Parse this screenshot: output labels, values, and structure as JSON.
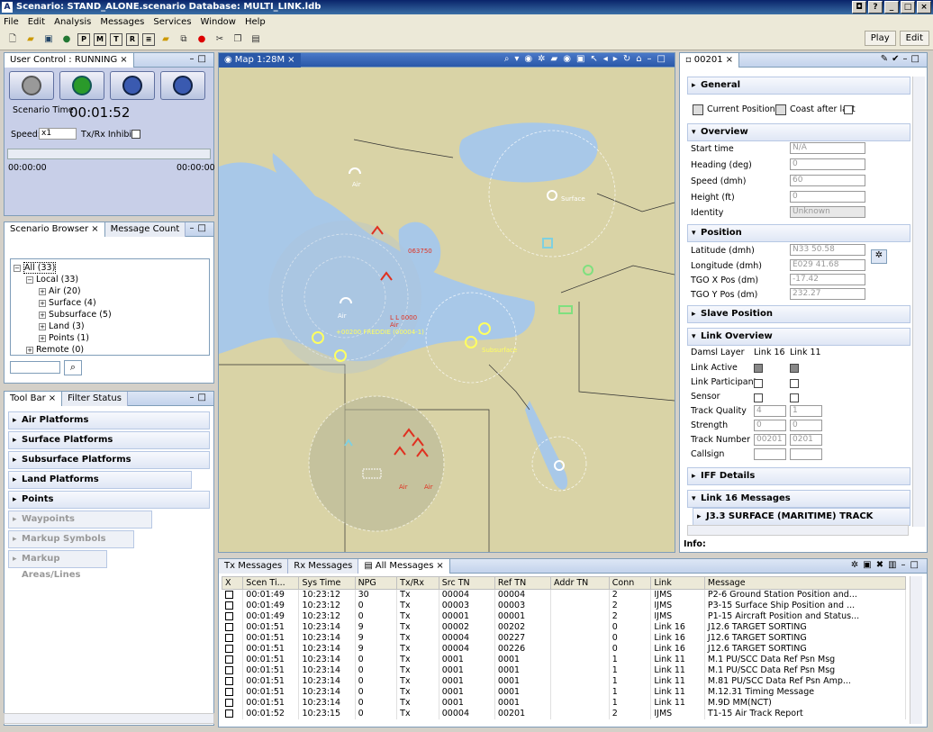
{
  "window": {
    "title": "Scenario: STAND_ALONE.scenario   Database: MULTI_LINK.ldb"
  },
  "menu": [
    "File",
    "Edit",
    "Analysis",
    "Messages",
    "Services",
    "Window",
    "Help"
  ],
  "perspectives": {
    "play": "Play",
    "edit": "Edit"
  },
  "user_control": {
    "tab": "User Control : RUNNING",
    "scenario_time_label": "Scenario Time",
    "scenario_time": "00:01:52",
    "speed_label": "Speed:",
    "speed_value": "x1",
    "txrx_label": "Tx/Rx Inhibit:",
    "timeline_start": "00:00:00",
    "timeline_end": "00:00:00"
  },
  "scenario_browser": {
    "tab": "Scenario Browser",
    "tab2": "Message Count",
    "tree": [
      {
        "label": "All (33)",
        "level": 0,
        "pm": "-"
      },
      {
        "label": "Local (33)",
        "level": 1,
        "pm": "-"
      },
      {
        "label": "Air (20)",
        "level": 2,
        "pm": "+"
      },
      {
        "label": "Surface (4)",
        "level": 2,
        "pm": "+"
      },
      {
        "label": "Subsurface (5)",
        "level": 2,
        "pm": "+"
      },
      {
        "label": "Land (3)",
        "level": 2,
        "pm": "+"
      },
      {
        "label": "Points (1)",
        "level": 2,
        "pm": "+"
      },
      {
        "label": "Remote (0)",
        "level": 1,
        "pm": "+"
      }
    ]
  },
  "toolbar_panel": {
    "tab": "Tool Bar",
    "tab2": "Filter Status",
    "sections": [
      {
        "label": "Air Platforms",
        "disabled": false
      },
      {
        "label": "Surface Platforms",
        "disabled": false
      },
      {
        "label": "Subsurface Platforms",
        "disabled": false
      },
      {
        "label": "Land Platforms",
        "disabled": false
      },
      {
        "label": "Points",
        "disabled": false
      },
      {
        "label": "Waypoints",
        "disabled": true
      },
      {
        "label": "Markup Symbols",
        "disabled": true
      },
      {
        "label": "Markup Areas/Lines",
        "disabled": true
      }
    ]
  },
  "map": {
    "tab": "Map 1:28M",
    "labels": [
      {
        "text": "Air",
        "color": "#ffffff"
      },
      {
        "text": "Air",
        "color": "#ffffff"
      },
      {
        "text": "Air",
        "color": "#e03020"
      },
      {
        "text": "Air",
        "color": "#e03020"
      },
      {
        "text": "Air",
        "color": "#e03020"
      },
      {
        "text": "Surface",
        "color": "#ffffff"
      },
      {
        "text": "Subsurface",
        "color": "#ffff60"
      },
      {
        "text": "L L 0000",
        "color": "#e03020"
      },
      {
        "text": "+00200 FREDDIE (00004-1)",
        "color": "#ffff60"
      },
      {
        "text": "063750",
        "color": "#e03020"
      }
    ]
  },
  "detail": {
    "tab": "00201",
    "general": "General",
    "current_position": "Current Position",
    "coast": "Coast after last",
    "overview": "Overview",
    "start_time_label": "Start time",
    "start_time": "N/A",
    "heading_label": "Heading (deg)",
    "heading": "0",
    "speed_label": "Speed (dmh)",
    "speed": "60",
    "height_label": "Height (ft)",
    "height": "0",
    "identity_label": "Identity",
    "identity": "Unknown",
    "position": "Position",
    "lat_label": "Latitude (dmh)",
    "lat": "N33 50.58",
    "lon_label": "Longitude (dmh)",
    "lon": "E029 41.68",
    "tgox_label": "TGO X Pos (dm)",
    "tgox": "-17.42",
    "tgoy_label": "TGO Y Pos (dm)",
    "tgoy": "232.27",
    "slave": "Slave Position",
    "link_overview": "Link Overview",
    "damsl": "Damsl Layer",
    "link16": "Link 16",
    "link11": "Link 11",
    "link_active": "Link Active",
    "link_participant": "Link Participant",
    "sensor": "Sensor",
    "track_quality": "Track Quality",
    "tq16": "4",
    "tq11": "1",
    "strength": "Strength",
    "st16": "0",
    "st11": "0",
    "track_number": "Track Number",
    "tn16": "00201",
    "tn11": "0201",
    "callsign": "Callsign",
    "iff": "IFF Details",
    "l16msgs": "Link 16 Messages",
    "j33": "J3.3 SURFACE (MARITIME) TRACK",
    "info": "Info:"
  },
  "messages": {
    "tabs": [
      "Tx Messages",
      "Rx Messages",
      "All Messages"
    ],
    "columns": [
      "X",
      "Scen Ti...",
      "Sys Time",
      "NPG",
      "Tx/Rx",
      "Src TN",
      "Ref TN",
      "Addr TN",
      "Conn",
      "Link",
      "Message"
    ],
    "rows": [
      [
        "00:01:49",
        "10:23:12",
        "30",
        "Tx",
        "00004",
        "00004",
        "",
        "2",
        "IJMS",
        "P2-6 Ground Station Position and..."
      ],
      [
        "00:01:49",
        "10:23:12",
        "0",
        "Tx",
        "00003",
        "00003",
        "",
        "2",
        "IJMS",
        "P3-15 Surface Ship Position and ..."
      ],
      [
        "00:01:49",
        "10:23:12",
        "0",
        "Tx",
        "00001",
        "00001",
        "",
        "2",
        "IJMS",
        "P1-15 Aircraft Position and Status..."
      ],
      [
        "00:01:51",
        "10:23:14",
        "9",
        "Tx",
        "00002",
        "00202",
        "",
        "0",
        "Link 16",
        "J12.6 TARGET SORTING"
      ],
      [
        "00:01:51",
        "10:23:14",
        "9",
        "Tx",
        "00004",
        "00227",
        "",
        "0",
        "Link 16",
        "J12.6 TARGET SORTING"
      ],
      [
        "00:01:51",
        "10:23:14",
        "9",
        "Tx",
        "00004",
        "00226",
        "",
        "0",
        "Link 16",
        "J12.6 TARGET SORTING"
      ],
      [
        "00:01:51",
        "10:23:14",
        "0",
        "Tx",
        "0001",
        "0001",
        "",
        "1",
        "Link 11",
        "M.1 PU/SCC Data Ref Psn Msg"
      ],
      [
        "00:01:51",
        "10:23:14",
        "0",
        "Tx",
        "0001",
        "0001",
        "",
        "1",
        "Link 11",
        "M.1 PU/SCC Data Ref Psn Msg"
      ],
      [
        "00:01:51",
        "10:23:14",
        "0",
        "Tx",
        "0001",
        "0001",
        "",
        "1",
        "Link 11",
        "M.81 PU/SCC Data Ref Psn Amp..."
      ],
      [
        "00:01:51",
        "10:23:14",
        "0",
        "Tx",
        "0001",
        "0001",
        "",
        "1",
        "Link 11",
        "M.12.31 Timing Message"
      ],
      [
        "00:01:51",
        "10:23:14",
        "0",
        "Tx",
        "0001",
        "0001",
        "",
        "1",
        "Link 11",
        "M.9D MM(NCT)"
      ],
      [
        "00:01:52",
        "10:23:15",
        "0",
        "Tx",
        "00004",
        "00201",
        "",
        "2",
        "IJMS",
        "T1-15 Air Track Report"
      ]
    ]
  }
}
